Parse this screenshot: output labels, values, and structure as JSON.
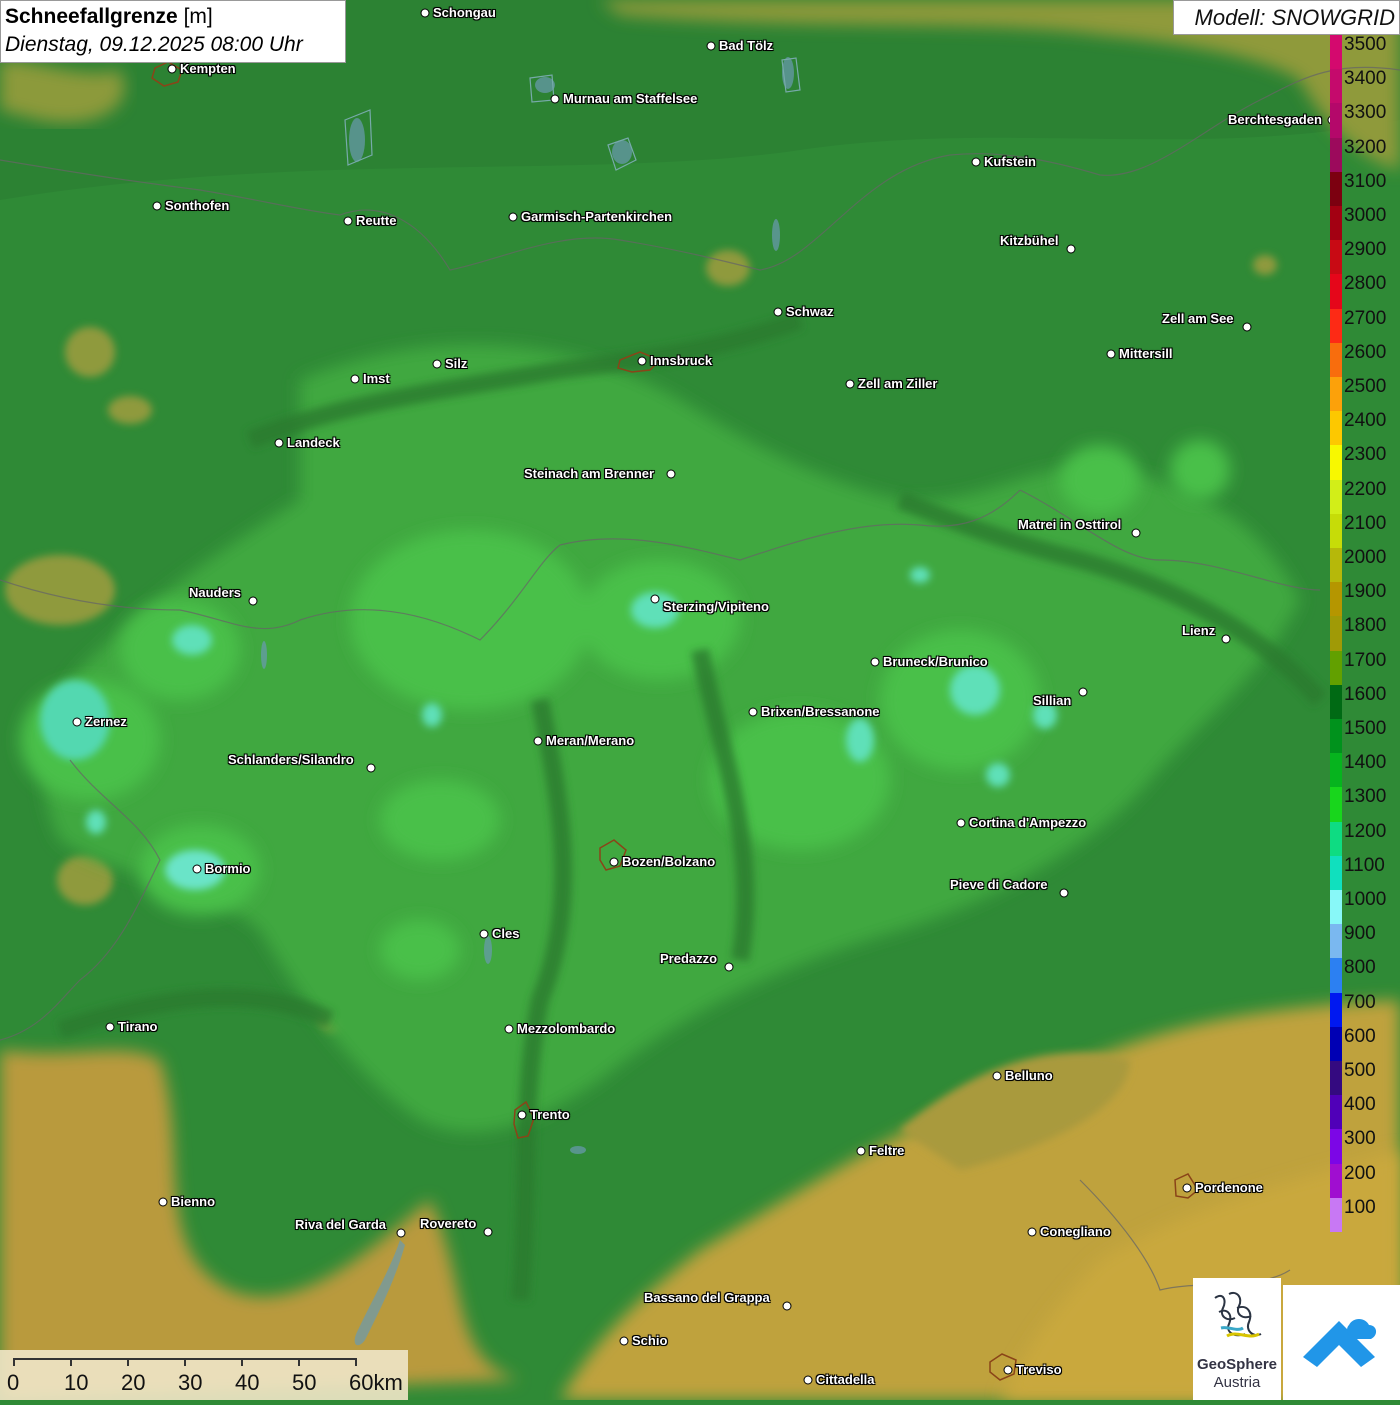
{
  "title": {
    "main": "Schneefallgrenze",
    "unit": "[m]",
    "date": "Dienstag, 09.12.2025 08:00 Uhr"
  },
  "model": "Modell: SNOWGRID",
  "legend": [
    {
      "label": "3500",
      "color": "#d4096e"
    },
    {
      "label": "3400",
      "color": "#c50a6c"
    },
    {
      "label": "3300",
      "color": "#b4086a"
    },
    {
      "label": "3200",
      "color": "#9c0a5c"
    },
    {
      "label": "3100",
      "color": "#7c0010"
    },
    {
      "label": "3000",
      "color": "#a30012"
    },
    {
      "label": "2900",
      "color": "#c80a14"
    },
    {
      "label": "2800",
      "color": "#e5061a"
    },
    {
      "label": "2700",
      "color": "#fd2a15"
    },
    {
      "label": "2600",
      "color": "#f86d0d"
    },
    {
      "label": "2500",
      "color": "#fca10a"
    },
    {
      "label": "2400",
      "color": "#fdc800"
    },
    {
      "label": "2300",
      "color": "#f8f800"
    },
    {
      "label": "2200",
      "color": "#d2ee18"
    },
    {
      "label": "2100",
      "color": "#c6dc08"
    },
    {
      "label": "2000",
      "color": "#b6b80a"
    },
    {
      "label": "1900",
      "color": "#b59600"
    },
    {
      "label": "1800",
      "color": "#a09a06"
    },
    {
      "label": "1700",
      "color": "#62a000"
    },
    {
      "label": "1600",
      "color": "#006a14"
    },
    {
      "label": "1500",
      "color": "#00921c"
    },
    {
      "label": "1400",
      "color": "#06b41e"
    },
    {
      "label": "1300",
      "color": "#18d61c"
    },
    {
      "label": "1200",
      "color": "#0edc82"
    },
    {
      "label": "1100",
      "color": "#10e0be"
    },
    {
      "label": "1000",
      "color": "#88f8f8"
    },
    {
      "label": "900",
      "color": "#7ab8f0"
    },
    {
      "label": "800",
      "color": "#2c80f2"
    },
    {
      "label": "700",
      "color": "#0018f0"
    },
    {
      "label": "600",
      "color": "#0000b4"
    },
    {
      "label": "500",
      "color": "#340a80"
    },
    {
      "label": "400",
      "color": "#5000b8"
    },
    {
      "label": "300",
      "color": "#7c06e6"
    },
    {
      "label": "200",
      "color": "#a00ed0"
    },
    {
      "label": "100",
      "color": "#c878f4"
    }
  ],
  "scale": {
    "labels": [
      "0",
      "10",
      "20",
      "30",
      "40",
      "50",
      "60km"
    ]
  },
  "cities": [
    {
      "name": "Schongau"
    },
    {
      "name": "Bad Tölz"
    },
    {
      "name": "Kempten"
    },
    {
      "name": "Murnau am Staffelsee"
    },
    {
      "name": "Berchtesgaden"
    },
    {
      "name": "Kufstein"
    },
    {
      "name": "Sonthofen"
    },
    {
      "name": "Reutte"
    },
    {
      "name": "Garmisch-Partenkirchen"
    },
    {
      "name": "Kitzbühel"
    },
    {
      "name": "Schwaz"
    },
    {
      "name": "Zell am See"
    },
    {
      "name": "Innsbruck"
    },
    {
      "name": "Mittersill"
    },
    {
      "name": "Imst"
    },
    {
      "name": "Silz"
    },
    {
      "name": "Zell am Ziller"
    },
    {
      "name": "Landeck"
    },
    {
      "name": "Steinach am Brenner"
    },
    {
      "name": "Matrei in Osttirol"
    },
    {
      "name": "Nauders"
    },
    {
      "name": "Sterzing/Vipiteno"
    },
    {
      "name": "Lienz"
    },
    {
      "name": "Bruneck/Brunico"
    },
    {
      "name": "Sillian"
    },
    {
      "name": "Zernez"
    },
    {
      "name": "Brixen/Bressanone"
    },
    {
      "name": "Meran/Merano"
    },
    {
      "name": "Schlanders/Silandro"
    },
    {
      "name": "Cortina d'Ampezzo"
    },
    {
      "name": "Bozen/Bolzano"
    },
    {
      "name": "Bormio"
    },
    {
      "name": "Pieve di Cadore"
    },
    {
      "name": "Cles"
    },
    {
      "name": "Predazzo"
    },
    {
      "name": "Tirano"
    },
    {
      "name": "Mezzolombardo"
    },
    {
      "name": "Belluno"
    },
    {
      "name": "Trento"
    },
    {
      "name": "Feltre"
    },
    {
      "name": "Pordenone"
    },
    {
      "name": "Bienno"
    },
    {
      "name": "Riva del Garda"
    },
    {
      "name": "Rovereto"
    },
    {
      "name": "Conegliano"
    },
    {
      "name": "Bassano del Grappa"
    },
    {
      "name": "Schio"
    },
    {
      "name": "Treviso"
    },
    {
      "name": "Cittadella"
    }
  ],
  "logos": {
    "geosphere_name": "GeoSphere",
    "geosphere_sub": "Austria"
  }
}
